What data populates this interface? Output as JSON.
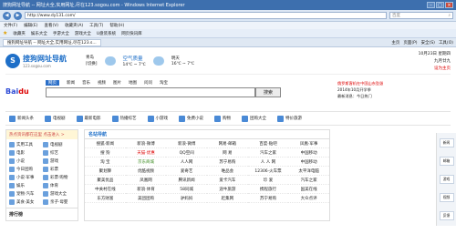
{
  "window": {
    "title": "搜狗网址导航 -- 网址大全,实用网址,尽在123.sogou.com - Windows Internet Explorer",
    "min": "–",
    "max": "□",
    "close": "×"
  },
  "address": {
    "url": "http://www.dy131.com/",
    "search_placeholder": "百度"
  },
  "menu": [
    "文件(F)",
    "编辑(E)",
    "查看(V)",
    "收藏夹(A)",
    "工具(T)",
    "帮助(H)"
  ],
  "favorites": {
    "label": "收藏夹",
    "items": [
      "娱乐大全",
      "手游大全",
      "游戏大全",
      "U盘装系统",
      "网页快讯库"
    ]
  },
  "tab": {
    "label": "搜狗网址导航 -- 网址大全,实用网址,尽在123.s...",
    "tools": [
      "主页",
      "页面(P)",
      "安全(S)",
      "工具(O)"
    ]
  },
  "site": {
    "logo_char": "S",
    "logo_title": "搜狗网址导航",
    "logo_sub": "123.sogou.com",
    "city": "青岛",
    "city_sub": "[切换]",
    "weather": "空气质量",
    "weather_val": "良",
    "temp": "14℃ ~ 7℃",
    "tomorrow": "明天",
    "tomorrow_temp": "16℃ ~ 7℃",
    "top_right_1": "10月23日 星期四",
    "top_right_2": "设为主页",
    "top_right_red": "·刷新",
    "top_right_3": "九月廿九"
  },
  "search": {
    "brand": "Bai",
    "brand_red": "du",
    "tabs": [
      "网页",
      "新闻",
      "音乐",
      "视频",
      "图片",
      "地图",
      "问问",
      "淘宝",
      "地图"
    ],
    "button": "搜索"
  },
  "hot": {
    "line1": "俄罗斯客机在中国山东坠毁",
    "line2": "2014年10月开学季",
    "line3": "最新消息：今日热门"
  },
  "quicknav": [
    "新闻头条",
    "电视剧",
    "最新电影",
    "热播综艺",
    "小游戏",
    "免费小说",
    "购物",
    "团购大全",
    "特价旅游"
  ],
  "left": {
    "note": "热点资讯都在这里 点击进入 >",
    "items": [
      "实用工具",
      "电视剧",
      "电影",
      "综艺",
      "小说",
      "游戏",
      "今日团购",
      "彩票",
      "小说·军事",
      "彩票·购物",
      "娱乐",
      "体育",
      "宠物·汽车",
      "游戏大全",
      "美食·美女",
      "亲子·母婴"
    ],
    "footer": "排行榜"
  },
  "main": {
    "title": "名站导航",
    "grid": [
      "搜狐·新闻",
      "新浪·微博",
      "新浪·微博",
      "网易·邮箱",
      "百度·贴吧",
      "凤凰·军事",
      "搜 狗",
      "天猫·优惠",
      "QQ空间",
      "网 易",
      "汽车之家",
      "中国移动",
      "淘 宝",
      "京东商城",
      "人人网",
      "苏宁易购",
      "人 人 网",
      "中国移动",
      "聚划算",
      "优酷视频",
      "爱奇艺",
      "唯品会",
      "12306·火车票",
      "太平洋电脑",
      "聚美优品",
      "凤凰网",
      "腾讯新闻",
      "爱卡汽车",
      "珍 爱",
      "汽车之家",
      "中关村在线",
      "新浪·体育",
      "58同城",
      "途牛旅游",
      "携程旅行",
      "国美在线",
      "东方财富",
      "美团团购",
      "驴妈妈",
      "赶集网",
      "苏宁易购",
      "大众点评"
    ]
  },
  "sidebar": [
    "新闻",
    "邮箱",
    "游戏",
    "视频",
    "反馈"
  ]
}
